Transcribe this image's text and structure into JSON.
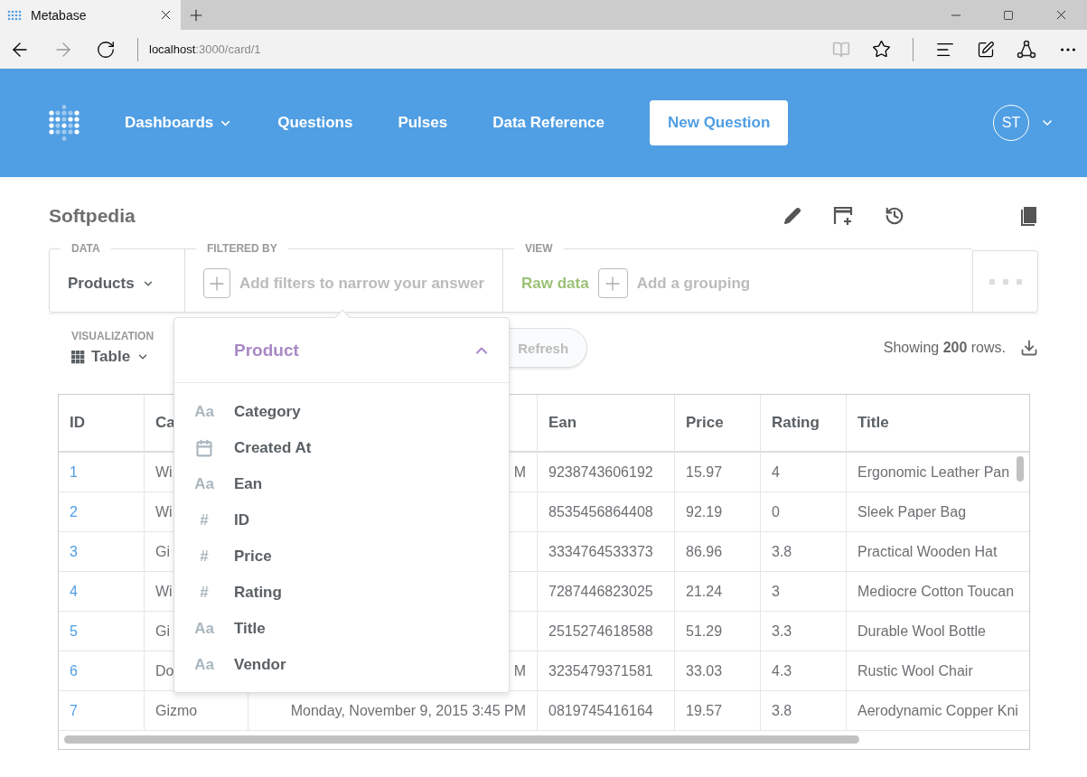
{
  "browser": {
    "tab_title": "Metabase",
    "url_host": "localhost",
    "url_path": ":3000/card/1"
  },
  "nav": {
    "items": [
      {
        "label": "Dashboards",
        "dropdown": true
      },
      {
        "label": "Questions",
        "dropdown": false
      },
      {
        "label": "Pulses",
        "dropdown": false
      },
      {
        "label": "Data Reference",
        "dropdown": false
      }
    ],
    "new_question": "New Question",
    "avatar": "ST"
  },
  "question": {
    "title": "Softpedia"
  },
  "query": {
    "data_label": "DATA",
    "data_value": "Products",
    "filter_label": "FILTERED BY",
    "filter_placeholder": "Add filters to narrow your answer",
    "view_label": "VIEW",
    "view_value": "Raw data",
    "grouping_placeholder": "Add a grouping"
  },
  "visualization": {
    "label": "VISUALIZATION",
    "value": "Table"
  },
  "refresh": "Refresh",
  "row_count": "Showing **200** rows.",
  "table": {
    "columns": [
      {
        "label": "ID",
        "link": true,
        "clipped_left": false
      },
      {
        "label": "Ca",
        "link": false,
        "clipped_left": false
      },
      {
        "link": false,
        "clipped_left": true
      },
      {
        "label": "Ean",
        "link": false,
        "clipped_left": false
      },
      {
        "label": "Price",
        "link": false,
        "clipped_left": false
      },
      {
        "label": "Rating",
        "link": false,
        "clipped_left": false
      },
      {
        "label": "Title",
        "link": false,
        "clipped_left": false
      }
    ],
    "rows": [
      [
        "1",
        "Wi",
        "M",
        "9238743606192",
        "15.97",
        "4",
        "Ergonomic Leather Pan"
      ],
      [
        "2",
        "Wi",
        null,
        "8535456864408",
        "92.19",
        "0",
        "Sleek Paper Bag"
      ],
      [
        "3",
        "Gi",
        null,
        "3334764533373",
        "86.96",
        "3.8",
        "Practical Wooden Hat"
      ],
      [
        "4",
        "Wi",
        null,
        "7287446823025",
        "21.24",
        "3",
        "Mediocre Cotton Toucan"
      ],
      [
        "5",
        "Gi",
        null,
        "2515274618588",
        "51.29",
        "3.3",
        "Durable Wool Bottle"
      ],
      [
        "6",
        "Do",
        "M",
        "3235479371581",
        "33.03",
        "4.3",
        "Rustic Wool Chair"
      ],
      [
        "7",
        "Gizmo",
        "Monday, November 9, 2015 3:45 PM",
        "0819745416164",
        "19.57",
        "3.8",
        "Aerodynamic Copper Kni"
      ]
    ]
  },
  "field_picker": {
    "title": "Product",
    "expanded": true,
    "fields": [
      {
        "kind": "text",
        "glyph": "Aa",
        "label": "Category"
      },
      {
        "kind": "date",
        "label": "Created At"
      },
      {
        "kind": "text",
        "glyph": "Aa",
        "label": "Ean"
      },
      {
        "kind": "number",
        "glyph": "#",
        "label": "ID"
      },
      {
        "kind": "number",
        "glyph": "#",
        "label": "Price"
      },
      {
        "kind": "number",
        "glyph": "#",
        "label": "Rating"
      },
      {
        "kind": "text",
        "glyph": "Aa",
        "label": "Title"
      },
      {
        "kind": "text",
        "glyph": "Aa",
        "label": "Vendor"
      }
    ]
  }
}
